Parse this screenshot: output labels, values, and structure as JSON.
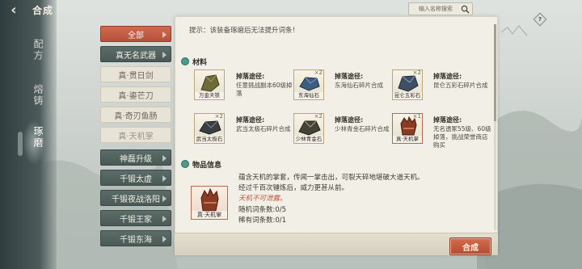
{
  "header": {
    "title": "合成"
  },
  "search": {
    "placeholder": "输入名称搜索"
  },
  "side_tabs": [
    {
      "label": "配方"
    },
    {
      "label": "熔铸"
    },
    {
      "label": "琢磨"
    }
  ],
  "list": {
    "items": [
      {
        "label": "全部",
        "style": "red"
      },
      {
        "label": "真无名武器",
        "style": "dark"
      },
      {
        "label": "真·贯日剑",
        "style": "light"
      },
      {
        "label": "真·鎏芒刀",
        "style": "light"
      },
      {
        "label": "真·奇刃鱼肠",
        "style": "light"
      },
      {
        "label": "真·天机掌",
        "style": "light-dim"
      },
      {
        "label": "神磊升级",
        "style": "dark"
      },
      {
        "label": "千锻太虚",
        "style": "dark"
      },
      {
        "label": "千锻夜战洛阳",
        "style": "dark"
      },
      {
        "label": "千锻王家",
        "style": "dark"
      },
      {
        "label": "千锻东海",
        "style": "dark"
      }
    ]
  },
  "hint": "提示：该装备琢磨后无法提升词条！",
  "materials": {
    "header": "材料",
    "source_label": "掉落途径:",
    "items": [
      {
        "name": "万金天铁",
        "qty": "",
        "desc": "任意挑战副本60级掉落"
      },
      {
        "name": "东海仙石",
        "qty": "×2",
        "desc": "东海仙石碎片合成"
      },
      {
        "name": "昆仑五彩石",
        "qty": "×2",
        "desc": "昆仑五彩石碎片合成"
      },
      {
        "name": "武当太极石",
        "qty": "×2",
        "desc": "武当太极石碎片合成"
      },
      {
        "name": "少林青金石",
        "qty": "×2",
        "desc": "少林青金石碎片合成"
      },
      {
        "name": "真·天机掌",
        "qty": "×1",
        "desc": "无名遗冢55级、60级掉落，挑战荣誉商店购买"
      }
    ]
  },
  "item_info": {
    "header": "物品信息",
    "name": "真·天机掌",
    "desc1": "蕴含天机的掌套，传闻一掌击出，可裂天碎地堪破大道天机。",
    "desc2": "经过千百次锤炼后，威力更甚从前。",
    "secret": "天机不可泄露。",
    "random_affix": "随机词条数:0/5",
    "rare_affix": "稀有词条数:0/1"
  },
  "actions": {
    "forge": "合成"
  },
  "help": {
    "label": "?"
  }
}
